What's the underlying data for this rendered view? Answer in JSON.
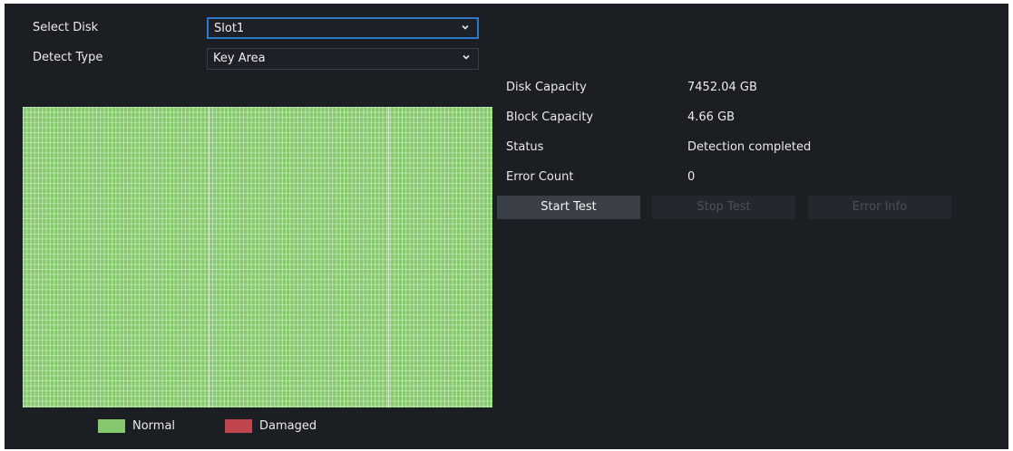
{
  "form": {
    "select_disk": {
      "label": "Select Disk",
      "value": "Slot1"
    },
    "detect_type": {
      "label": "Detect Type",
      "value": "Key Area"
    }
  },
  "info": {
    "disk_capacity": {
      "label": "Disk Capacity",
      "value": "7452.04 GB"
    },
    "block_capacity": {
      "label": "Block Capacity",
      "value": "4.66 GB"
    },
    "status": {
      "label": "Status",
      "value": "Detection completed"
    },
    "error_count": {
      "label": "Error Count",
      "value": "0"
    }
  },
  "buttons": {
    "start_test": "Start Test",
    "stop_test": "Stop Test",
    "error_info": "Error Info"
  },
  "legend": {
    "normal": {
      "label": "Normal",
      "color": "#86c86e"
    },
    "damaged": {
      "label": "Damaged",
      "color": "#c0454f"
    }
  },
  "icons": {
    "dropdown": "chevron-down-icon"
  }
}
